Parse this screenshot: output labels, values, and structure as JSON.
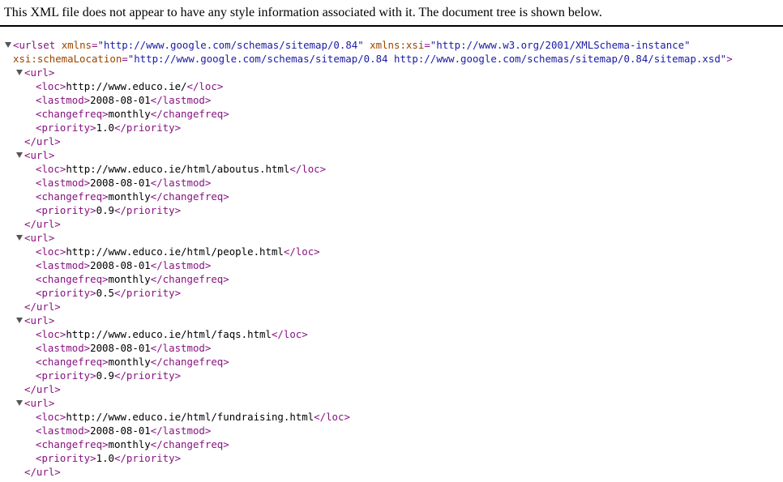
{
  "header": {
    "message": "This XML file does not appear to have any style information associated with it. The document tree is shown below."
  },
  "root": {
    "open_name": "<urlset",
    "xmlns_attr": "xmlns",
    "xmlns_val": "\"http://www.google.com/schemas/sitemap/0.84\"",
    "xsi_attr": "xmlns:xsi",
    "xsi_val": "\"http://www.w3.org/2001/XMLSchema-instance\"",
    "loc_attr": "xsi:schemaLocation",
    "loc_val": "\"http://www.google.com/schemas/sitemap/0.84 http://www.google.com/schemas/sitemap/0.84/sitemap.xsd\"",
    "close_bracket": ">"
  },
  "tags": {
    "url_open": "<url>",
    "url_close": "</url>",
    "loc_open": "<loc>",
    "loc_close": "</loc>",
    "lastmod_open": "<lastmod>",
    "lastmod_close": "</lastmod>",
    "changefreq_open": "<changefreq>",
    "changefreq_close": "</changefreq>",
    "priority_open": "<priority>",
    "priority_close": "</priority>"
  },
  "urls": [
    {
      "loc": "http://www.educo.ie/",
      "lastmod": "2008-08-01",
      "changefreq": "monthly",
      "priority": "1.0"
    },
    {
      "loc": "http://www.educo.ie/html/aboutus.html",
      "lastmod": "2008-08-01",
      "changefreq": "monthly",
      "priority": "0.9"
    },
    {
      "loc": "http://www.educo.ie/html/people.html",
      "lastmod": "2008-08-01",
      "changefreq": "monthly",
      "priority": "0.5"
    },
    {
      "loc": "http://www.educo.ie/html/faqs.html",
      "lastmod": "2008-08-01",
      "changefreq": "monthly",
      "priority": "0.9"
    },
    {
      "loc": "http://www.educo.ie/html/fundraising.html",
      "lastmod": "2008-08-01",
      "changefreq": "monthly",
      "priority": "1.0"
    }
  ]
}
